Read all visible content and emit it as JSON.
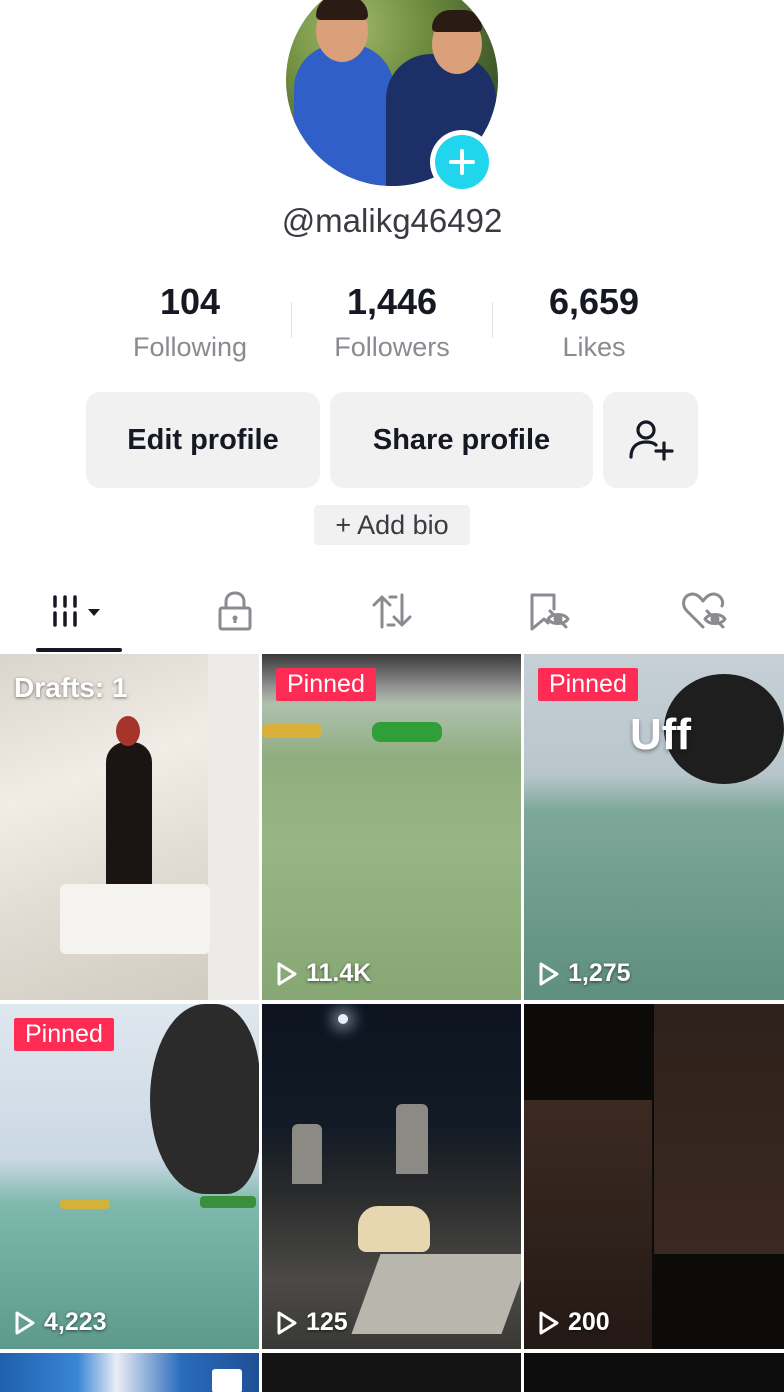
{
  "profile": {
    "username": "@malikg46492",
    "stats": [
      {
        "value": "104",
        "label": "Following"
      },
      {
        "value": "1,446",
        "label": "Followers"
      },
      {
        "value": "6,659",
        "label": "Likes"
      }
    ],
    "edit_label": "Edit profile",
    "share_label": "Share profile",
    "add_bio_label": "+ Add bio"
  },
  "tabs": [
    {
      "icon": "videos-grid-icon",
      "active": true
    },
    {
      "icon": "lock-icon"
    },
    {
      "icon": "repost-icon"
    },
    {
      "icon": "favorites-hidden-icon"
    },
    {
      "icon": "liked-hidden-icon"
    }
  ],
  "videos": [
    {
      "drafts": "Drafts: 1",
      "views": ""
    },
    {
      "badge": "Pinned",
      "views": "11.4K"
    },
    {
      "badge": "Pinned",
      "overlay_text": "Uff",
      "views": "1,275"
    },
    {
      "badge": "Pinned",
      "views": "4,223"
    },
    {
      "views": "125"
    },
    {
      "views": "200"
    }
  ],
  "colors": {
    "accent": "#fe2c55",
    "avatar_add": "#20d5ec",
    "button_bg": "#f1f1f2",
    "secondary_text": "#8a8b91"
  }
}
